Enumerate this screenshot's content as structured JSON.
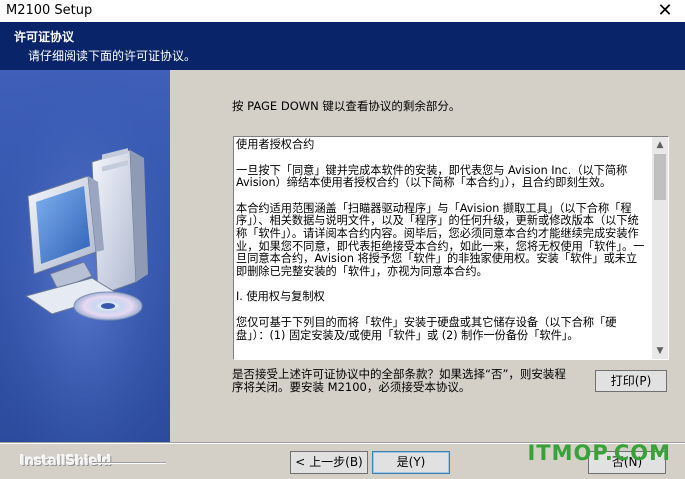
{
  "window": {
    "title": "M2100 Setup",
    "close_glyph": "✕"
  },
  "header": {
    "title": "许可证协议",
    "subtitle": "请仔细阅读下面的许可证协议。"
  },
  "instruction": "按 PAGE DOWN 键以查看协议的剩余部分。",
  "license": {
    "paragraphs": [
      "使用者授权合约",
      "一旦按下「同意」键并完成本软件的安装，即代表您与 Avision Inc.（以下简称 Avision）缔结本使用者授权合约（以下简称「本合约」），且合约即刻生效。",
      "本合约适用范围涵盖「扫瞄器驱动程序」与「Avision 撷取工具」（以下合称「程序」）、相关数据与说明文件，以及「程序」的任何升级，更新或修改版本（以下统称「软件」）。请详阅本合约内容。阅毕后，您必须同意本合约才能继续完成安装作业，如果您不同意，即代表拒绝接受本合约，如此一来，您将无权使用「软件」。一旦同意本合约，Avision 将授予您「软件」的非独家使用权。安装「软件」或未立即删除已完整安装的「软件」，亦视为同意本合约。",
      "I. 使用权与复制权",
      "您仅可基于下列目的而将「软件」安装于硬盘或其它储存设备（以下合称「硬盘」）：(1) 固定安装及/或使用「软件」或 (2) 制作一份备份「软件」。"
    ]
  },
  "question": "是否接受上述许可证协议中的全部条款？如果选择“否”，则安装程序将关闭。要安装 M2100，必须接受本协议。",
  "buttons": {
    "print": "打印(P)",
    "back": "< 上一步(B)",
    "yes": "是(Y)",
    "no": "否(N)"
  },
  "footer": {
    "brand": "InstallShield"
  },
  "watermark": "ITMOP.COM",
  "colors": {
    "header_bg": "#0a246a",
    "side_panel": "#3557ad",
    "dialog_bg": "#d4d0c8",
    "watermark": "#38a138"
  },
  "icons": {
    "side_art": "computer-with-cd-icon",
    "scroll_up": "scroll-up-arrow-icon",
    "scroll_down": "scroll-down-arrow-icon"
  }
}
